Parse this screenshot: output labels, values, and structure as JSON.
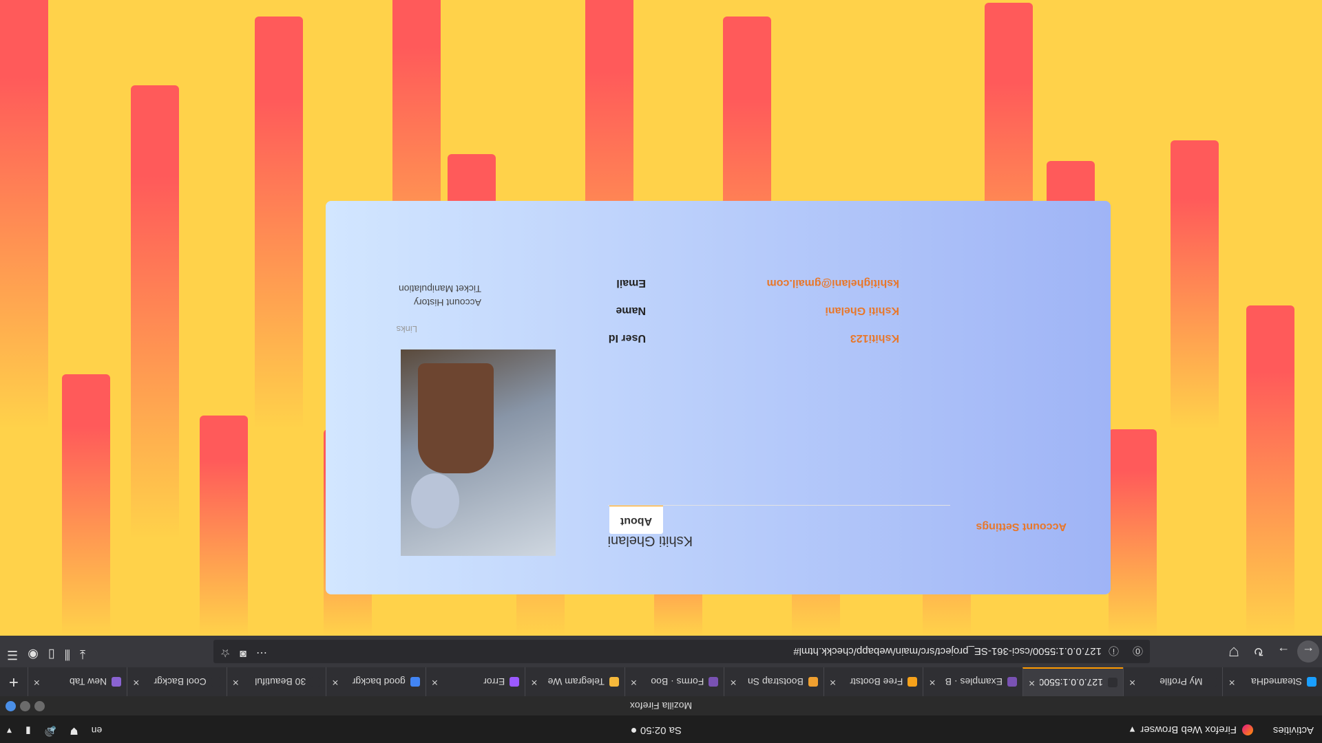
{
  "topbar": {
    "activities": "Activities",
    "app_name": "Firefox Web Browser",
    "clock": "Sa 02:50",
    "lang": "en"
  },
  "window": {
    "title": "Mozilla Firefox"
  },
  "tabs": [
    {
      "label": "SteamedHa",
      "color": "#1a9fff"
    },
    {
      "label": "My Profile",
      "color": "#2f2f33"
    },
    {
      "label": "127.0.0.1:5500/",
      "color": "#2f2f33"
    },
    {
      "label": "Examples · B",
      "color": "#7952b3"
    },
    {
      "label": "Free Bootstr",
      "color": "#f7a21b"
    },
    {
      "label": "Bootstrap Sn",
      "color": "#f0a030"
    },
    {
      "label": "Forms · Boo",
      "color": "#7952b3"
    },
    {
      "label": "Telegram We",
      "color": "#f6b93b"
    },
    {
      "label": "Error",
      "color": "#9b59ff"
    },
    {
      "label": "good backgr",
      "color": "#4285f4"
    },
    {
      "label": "30 Beautiful",
      "color": "#2f2f33"
    },
    {
      "label": "Cool Backgr",
      "color": "#2f2f33"
    },
    {
      "label": "New Tab",
      "color": "#8a63d2"
    }
  ],
  "url": "127.0.0.1:5500/csci-361-SE_project/src/main/webapp/checkk.html#",
  "profile": {
    "account_settings": "Account Settings",
    "name": "Kshiti Ghelani",
    "about_tab": "About",
    "fields": [
      {
        "label": "User Id",
        "value": "Kshiti123"
      },
      {
        "label": "Name",
        "value": "Kshiti Ghelani"
      },
      {
        "label": "Email",
        "value": "kshitighelani@gmail.com"
      }
    ],
    "links_title": "Links",
    "links": [
      "Account History",
      "Ticket Manipulation"
    ]
  }
}
